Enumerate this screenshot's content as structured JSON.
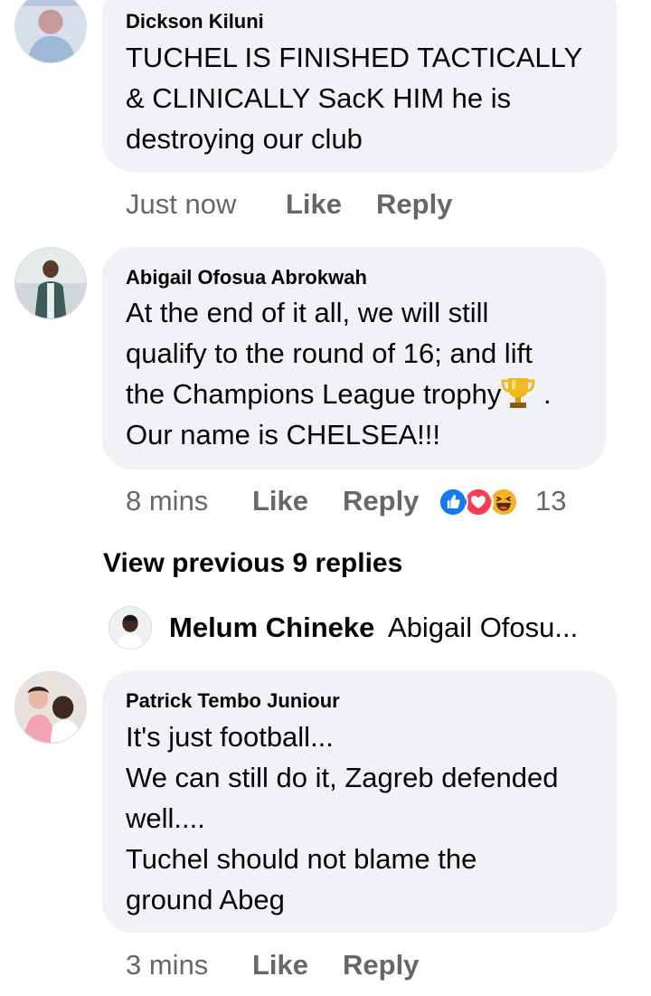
{
  "comments": [
    {
      "author": "Dickson Kiluni",
      "lines": [
        "TUCHEL IS FINISHED TACTICALLY",
        "& CLINICALLY SacK HIM he is",
        "destroying our club"
      ],
      "time": "Just now",
      "like_label": "Like",
      "reply_label": "Reply"
    },
    {
      "author": "Abigail Ofosua Abrokwah",
      "lines": [
        "At the end of it all, we will still",
        "qualify to the round of 16; and lift",
        "the Champions League trophy",
        "Our name is CHELSEA!!!"
      ],
      "line3_suffix": " .",
      "emoji": "trophy-icon",
      "time": "8 mins",
      "like_label": "Like",
      "reply_label": "Reply",
      "reactions": [
        "like-reaction-icon",
        "love-reaction-icon",
        "haha-reaction-icon"
      ],
      "reaction_count": "13"
    },
    {
      "author": "Patrick Tembo Juniour",
      "lines": [
        "It's just football...",
        "We can still do it, Zagreb defended",
        "well....",
        "Tuchel should not blame the",
        "ground Abeg"
      ],
      "time": "3 mins",
      "like_label": "Like",
      "reply_label": "Reply"
    }
  ],
  "view_previous": "View previous 9 replies",
  "reply_preview": {
    "author": "Melum Chineke",
    "text": "Abigail Ofosu..."
  },
  "colors": {
    "bubble": "#f0f2f5",
    "meta_text": "#65676b",
    "like_blue": "#1877f2",
    "love_red": "#f33e58",
    "haha_yellow": "#f7b125"
  }
}
